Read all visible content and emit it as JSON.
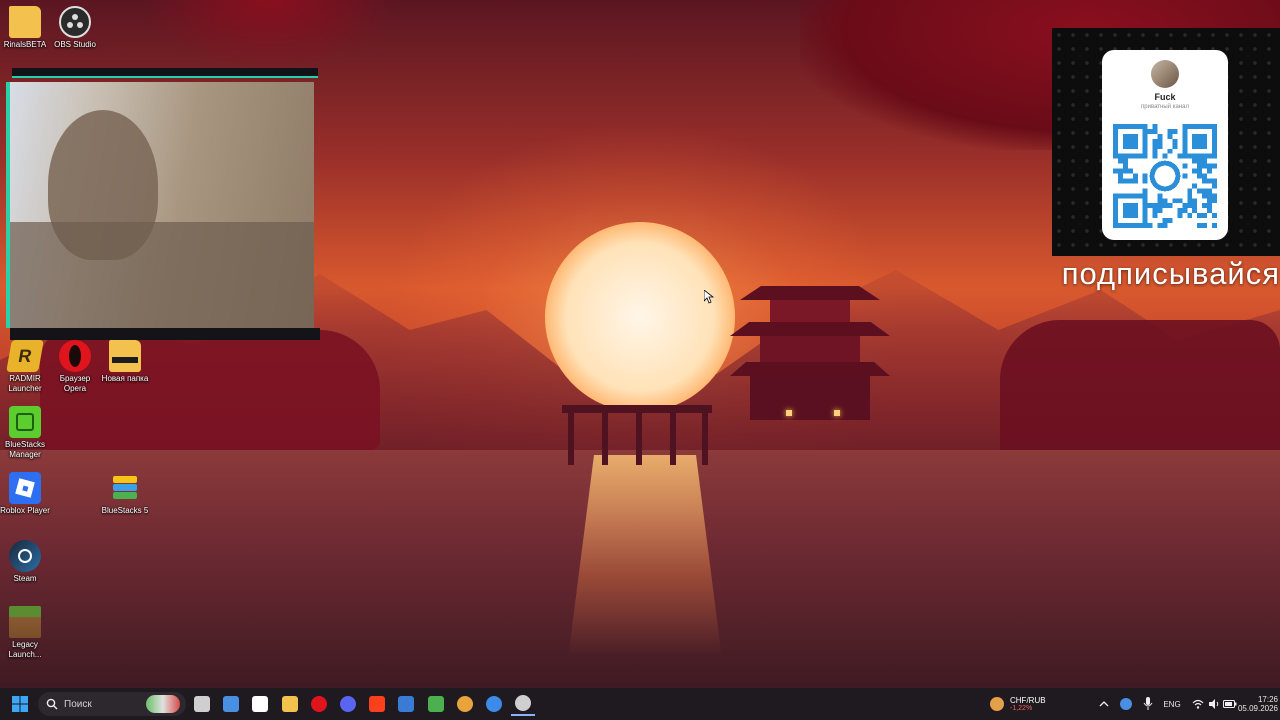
{
  "desktop_icons": [
    {
      "label": "RinalsBETA",
      "icon": "folder-icon",
      "color": "#f2c14e"
    },
    {
      "label": "OBS Studio",
      "icon": "obs-icon",
      "color": "#2b2b2b"
    },
    {
      "label": "RADMIR Launcher",
      "icon": "radmir-icon",
      "color": "#e8b22a"
    },
    {
      "label": "Браузер Opera",
      "icon": "opera-icon",
      "color": "#e0141c"
    },
    {
      "label": "Новая папка",
      "icon": "folder-icon",
      "color": "#f2c14e"
    },
    {
      "label": "BlueStacks Manager",
      "icon": "bluestacks-manager-icon",
      "color": "#5ccd2e"
    },
    {
      "label": "Roblox Player",
      "icon": "roblox-icon",
      "color": "#2d6ff0"
    },
    {
      "label": "BlueStacks 5",
      "icon": "bluestacks-icon",
      "color": "#4caf50"
    },
    {
      "label": "Steam",
      "icon": "steam-icon",
      "color": "#1b2838"
    },
    {
      "label": "Legacy Launch...",
      "icon": "minecraft-icon",
      "color": "#5b8c32"
    }
  ],
  "qr_widget": {
    "channel_name": "Fuck",
    "channel_type": "приватный канал",
    "caption": "подписывайся"
  },
  "taskbar": {
    "search_placeholder": "Поиск",
    "ticker_pair": "CHF/RUB",
    "ticker_change": "-1,22%",
    "language": "ENG",
    "time": "17:26",
    "date": "05.09.2026",
    "pinned": [
      {
        "name": "task-view-icon",
        "color": "#cfcfcf"
      },
      {
        "name": "widgets-icon",
        "color": "#4a90e2"
      },
      {
        "name": "yandex-browser-icon",
        "color": "#ffffff"
      },
      {
        "name": "file-explorer-icon",
        "color": "#f2c14e"
      },
      {
        "name": "opera-icon",
        "color": "#e0141c"
      },
      {
        "name": "discord-icon",
        "color": "#5865f2"
      },
      {
        "name": "yandex-icon",
        "color": "#fc3f1d"
      },
      {
        "name": "microsoft-store-icon",
        "color": "#3a7bd5"
      },
      {
        "name": "bluestacks-icon",
        "color": "#4caf50"
      },
      {
        "name": "chromium-icon",
        "color": "#e8a33c"
      },
      {
        "name": "radeon-icon",
        "color": "#3c8be8"
      },
      {
        "name": "obs-icon",
        "color": "#cfcfcf"
      }
    ]
  }
}
